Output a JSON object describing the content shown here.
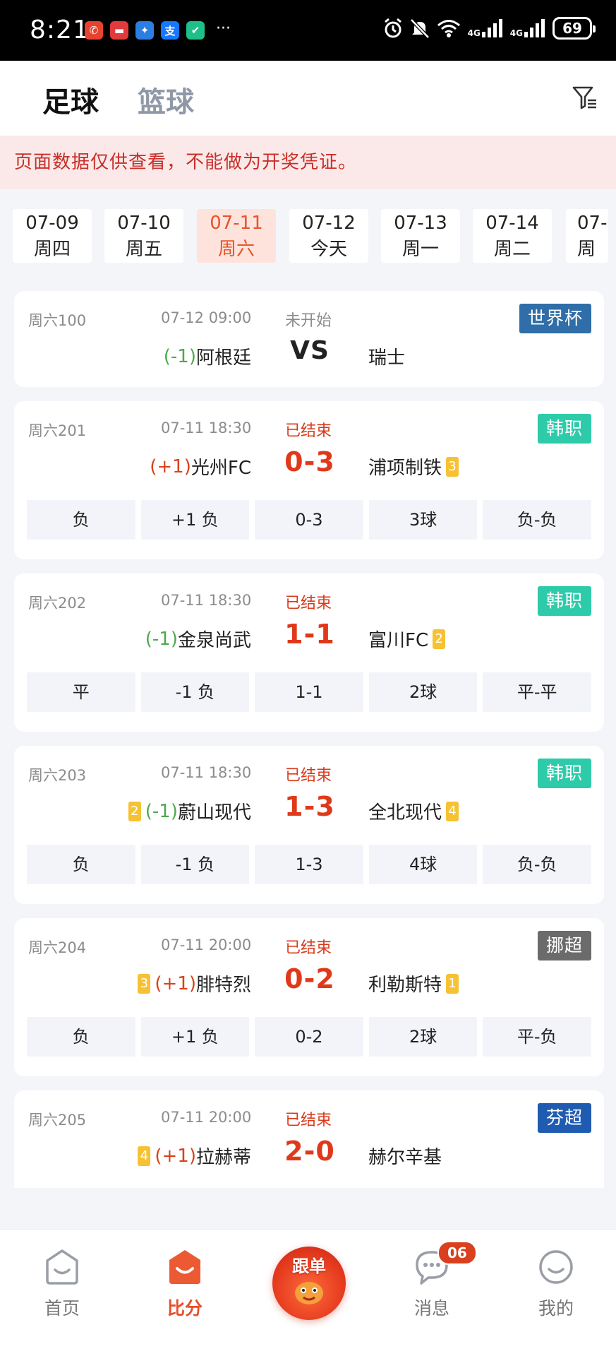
{
  "status_bar": {
    "time": "8:21",
    "battery": "69",
    "signal_label_1": "4G",
    "signal_label_2": "4G",
    "more": "···"
  },
  "header": {
    "tab_football": "足球",
    "tab_basketball": "篮球"
  },
  "notice": "页面数据仅供查看，不能做为开奖凭证。",
  "dates": [
    {
      "date": "07-09",
      "day": "周四",
      "active": false
    },
    {
      "date": "07-10",
      "day": "周五",
      "active": false
    },
    {
      "date": "07-11",
      "day": "周六",
      "active": true
    },
    {
      "date": "07-12",
      "day": "今天",
      "active": false
    },
    {
      "date": "07-13",
      "day": "周一",
      "active": false
    },
    {
      "date": "07-14",
      "day": "周二",
      "active": false
    },
    {
      "date": "07-",
      "day": "周",
      "active": false
    }
  ],
  "matches": [
    {
      "no": "周六100",
      "time": "07-12 09:00",
      "status": "未开始",
      "league": "世界杯",
      "league_color": "#2f6ea8",
      "home_handicap": "(-1)",
      "home": "阿根廷",
      "home_card": "",
      "home_card_left": "",
      "score": "VS",
      "away": "瑞士",
      "away_card": "",
      "results": []
    },
    {
      "no": "周六201",
      "time": "07-11 18:30",
      "status": "已结束",
      "league": "韩职",
      "league_color": "#2ecbaa",
      "home_handicap": "(+1)",
      "home": "光州FC",
      "home_card": "",
      "home_card_left": "",
      "score": "0-3",
      "away": "浦项制铁",
      "away_card": "3",
      "results": [
        "负",
        "+1 负",
        "0-3",
        "3球",
        "负-负"
      ]
    },
    {
      "no": "周六202",
      "time": "07-11 18:30",
      "status": "已结束",
      "league": "韩职",
      "league_color": "#2ecbaa",
      "home_handicap": "(-1)",
      "home": "金泉尚武",
      "home_card": "",
      "home_card_left": "",
      "score": "1-1",
      "away": "富川FC",
      "away_card": "2",
      "results": [
        "平",
        "-1 负",
        "1-1",
        "2球",
        "平-平"
      ]
    },
    {
      "no": "周六203",
      "time": "07-11 18:30",
      "status": "已结束",
      "league": "韩职",
      "league_color": "#2ecbaa",
      "home_handicap": "(-1)",
      "home": "蔚山现代",
      "home_card": "",
      "home_card_left": "2",
      "score": "1-3",
      "away": "全北现代",
      "away_card": "4",
      "results": [
        "负",
        "-1 负",
        "1-3",
        "4球",
        "负-负"
      ]
    },
    {
      "no": "周六204",
      "time": "07-11 20:00",
      "status": "已结束",
      "league": "挪超",
      "league_color": "#6b6b6b",
      "home_handicap": "(+1)",
      "home": "腓特烈",
      "home_card": "",
      "home_card_left": "3",
      "score": "0-2",
      "away": "利勒斯特",
      "away_card": "1",
      "results": [
        "负",
        "+1 负",
        "0-2",
        "2球",
        "平-负"
      ]
    },
    {
      "no": "周六205",
      "time": "07-11 20:00",
      "status": "已结束",
      "league": "芬超",
      "league_color": "#1f5bb0",
      "home_handicap": "(+1)",
      "home": "拉赫蒂",
      "home_card": "",
      "home_card_left": "4",
      "score": "2-0",
      "away": "赫尔辛基",
      "away_card": "",
      "results": [
        "",
        "",
        "",
        "",
        ""
      ]
    }
  ],
  "bottom_nav": {
    "home": "首页",
    "score": "比分",
    "follow": "跟单",
    "messages": "消息",
    "messages_badge": "06",
    "mine": "我的"
  }
}
